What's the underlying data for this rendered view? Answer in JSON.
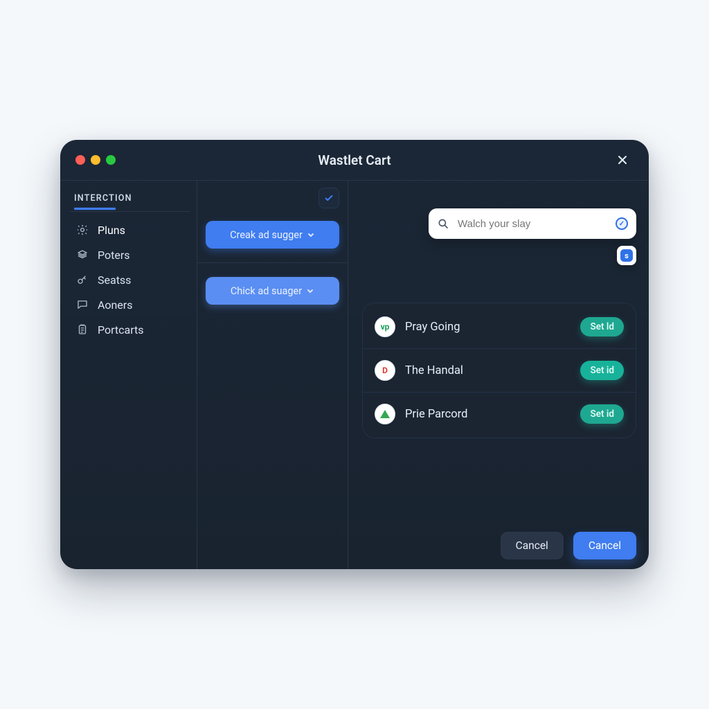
{
  "window": {
    "title": "Wastlet Cart"
  },
  "sidebar": {
    "heading": "INTERCTION",
    "items": [
      {
        "label": "Pluns",
        "icon": "gear-icon"
      },
      {
        "label": "Poters",
        "icon": "stack-icon"
      },
      {
        "label": "Seatss",
        "icon": "key-icon"
      },
      {
        "label": "Aoners",
        "icon": "chat-icon"
      },
      {
        "label": "Portcarts",
        "icon": "clipboard-icon"
      }
    ]
  },
  "middle": {
    "buttons": [
      {
        "label": "Creak ad sugger"
      },
      {
        "label": "Chick ad suager"
      }
    ]
  },
  "search": {
    "placeholder": "Walch your slay",
    "chip_letter": "s"
  },
  "results": [
    {
      "label": "Pray Going",
      "avatar": "vp",
      "avatar_style": "green",
      "action": "Set ld"
    },
    {
      "label": "The Handal",
      "avatar": "D",
      "avatar_style": "red",
      "action": "Set id"
    },
    {
      "label": "Prie Parcord",
      "avatar": "triangle",
      "avatar_style": "tri",
      "action": "Set id"
    }
  ],
  "footer": {
    "secondary": "Cancel",
    "primary": "Cancel"
  }
}
